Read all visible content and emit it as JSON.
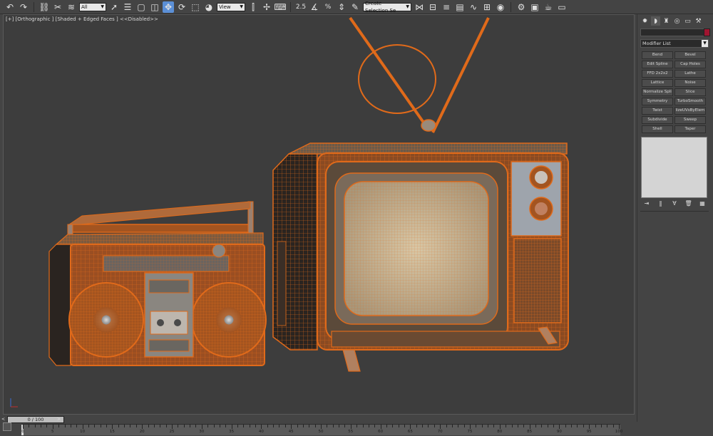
{
  "toolbar": {
    "selection_filter": "All",
    "reference_coord": "View",
    "named_selection": "Create Selection Se",
    "snap_angle_label": "2.5",
    "snap_percent_label": "%"
  },
  "viewport": {
    "label": "[+] [Orthographic ] [Shaded + Edged Faces ] <<Disabled>>"
  },
  "command_panel": {
    "modifier_list_label": "Modifier List",
    "modifiers": [
      "Bend",
      "Bevel",
      "Edit Spline",
      "Cap Holes",
      "FFD 2x2x2",
      "Lathe",
      "Lattice",
      "Noise",
      "Normalize Spli",
      "Slice",
      "Symmetry",
      "TurboSmooth",
      "Twist",
      "lizeUVsByElem",
      "Subdivide",
      "Sweep",
      "Shell",
      "Taper"
    ],
    "name_color": "#a01530"
  },
  "timeline": {
    "frame_display": "0 / 100",
    "ticks": [
      "0",
      "5",
      "10",
      "15",
      "20",
      "25",
      "30",
      "35",
      "40",
      "45",
      "50",
      "55",
      "60",
      "65",
      "70",
      "75",
      "80",
      "85",
      "90",
      "95",
      "100"
    ]
  },
  "scene": {
    "wire_color": "#e06a1a",
    "objects": [
      "boombox",
      "television"
    ]
  }
}
